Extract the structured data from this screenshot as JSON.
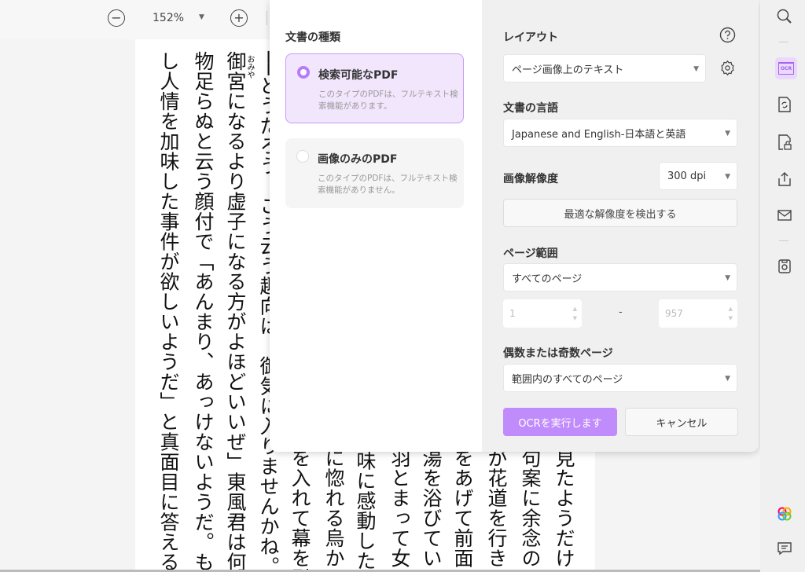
{
  "toolbar": {
    "zoom": "152%",
    "zoom_out": "−",
    "zoom_in": "+"
  },
  "page": {
    "columns": [
      "──どうだろう　こう云う趣向は　御気に入りませんかね。",
      "御宮になるより虚子になる方がよほどいいぜ」東風君は何",
      "物足らぬと云う顔付で「あんまり、あっけないようだ。も",
      "し人情を加味した事件が欲しいようだ」と真面目に答える。"
    ],
    "ruby": "おみや",
    "partial_columns": [
      "見たようだけ",
      "句案に余念の",
      "が花道を行き",
      "をあげて前面",
      "湯を浴びてい",
      "羽とまって女",
      "、味に感動した",
      "に惚れる烏か",
      "を入れて幕を引"
    ]
  },
  "dialog": {
    "doc_type_label": "文書の種類",
    "options": [
      {
        "title": "検索可能なPDF",
        "desc": "このタイプのPDFは、フルテキスト検索機能があります。",
        "selected": true
      },
      {
        "title": "画像のみのPDF",
        "desc": "このタイプのPDFは、フルテキスト検索機能がありません。",
        "selected": false
      }
    ],
    "layout_label": "レイアウト",
    "layout_value": "ページ画像上のテキスト",
    "language_label": "文書の言語",
    "language_value": "Japanese and English-日本語と英語",
    "resolution_label": "画像解像度",
    "resolution_value": "300 dpi",
    "detect_button": "最適な解像度を検出する",
    "page_range_label": "ページ範囲",
    "page_range_value": "すべてのページ",
    "range_from": "1",
    "range_dash": "-",
    "range_to": "957",
    "even_odd_label": "偶数または奇数ページ",
    "even_odd_value": "範囲内のすべてのページ",
    "ocr_button": "OCRを実行します",
    "cancel_button": "キャンセル",
    "ocr_icon_text": "OCR"
  },
  "colors": {
    "accent": "#c08cfc",
    "card_bg": "#f2e6fd"
  }
}
